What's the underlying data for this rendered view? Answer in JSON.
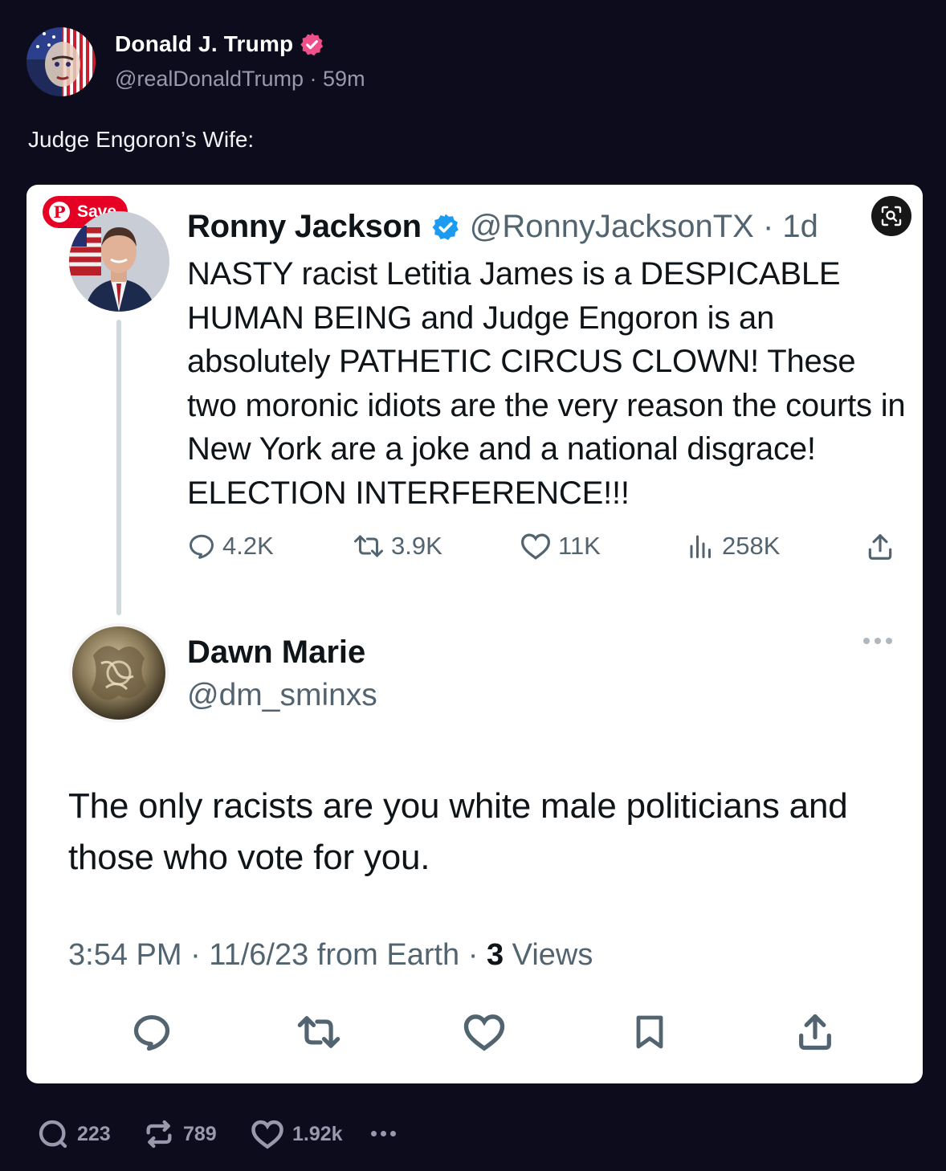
{
  "post": {
    "author_name": "Donald J. Trump",
    "handle": "@realDonaldTrump",
    "separator": "·",
    "time": "59m",
    "text": "Judge Engoron’s Wife:",
    "replies": "223",
    "reposts": "789",
    "likes": "1.92k"
  },
  "embed": {
    "save_label": "Save",
    "original_tweet": {
      "name": "Ronny Jackson",
      "handle_time": "@RonnyJacksonTX · 1d",
      "text": "NASTY racist Letitia James is a DESPICABLE HUMAN BEING and Judge Engoron is an absolutely PATHETIC CIRCUS CLOWN!  These two moronic idiots are the very reason the courts in New York are a joke and a national disgrace! ELECTION INTERFERENCE!!!",
      "replies": "4.2K",
      "retweets": "3.9K",
      "likes": "11K",
      "views": "258K"
    },
    "reply_tweet": {
      "name": "Dawn Marie",
      "handle": "@dm_sminxs",
      "text": "The only racists are you white male politicians and those who vote for you.",
      "meta_prefix": "3:54 PM · 11/6/23 from Earth · ",
      "views_count": "3",
      "views_label": " Views"
    }
  },
  "colors": {
    "background": "#0d0c1d",
    "card": "#ffffff",
    "pinterest_red": "#e60023",
    "x_verified_blue": "#1d9bf0",
    "truth_verified_pink": "#f0508a",
    "muted_text": "#536471"
  },
  "icons": [
    "verified-badge-icon",
    "pinterest-icon",
    "visual-search-icon",
    "reply-icon",
    "retweet-icon",
    "like-icon",
    "views-icon",
    "share-icon",
    "bookmark-icon",
    "more-icon"
  ]
}
